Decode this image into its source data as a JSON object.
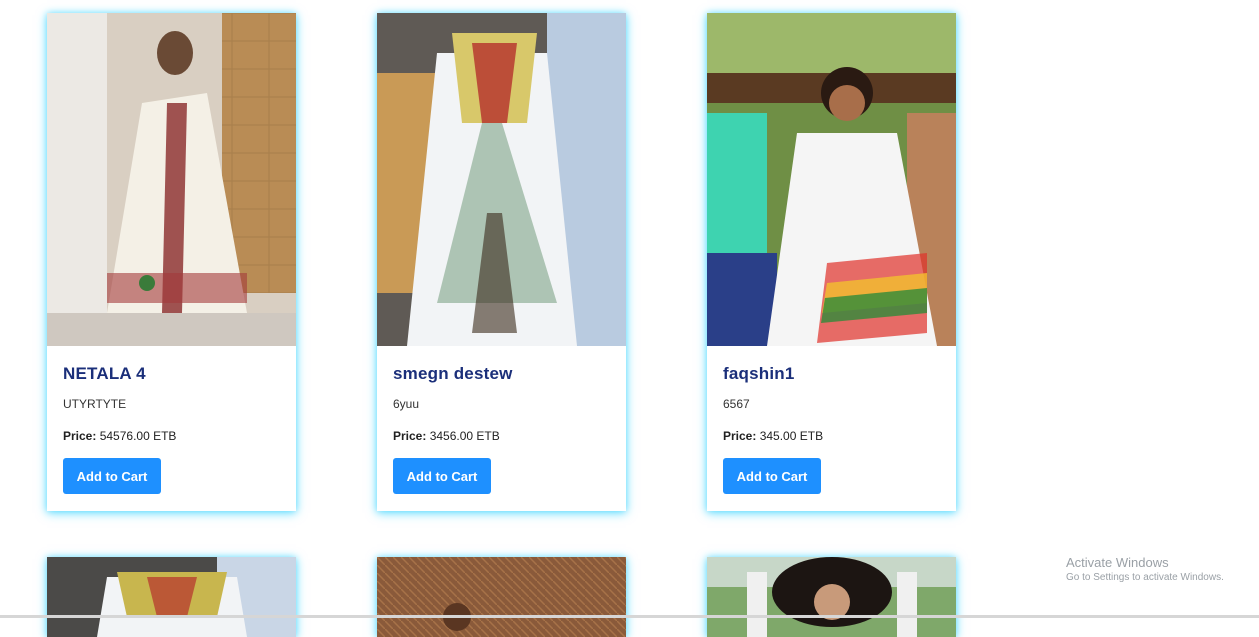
{
  "products": [
    {
      "name": "NETALA 4",
      "description": "UTYRTYTE",
      "price_label": "Price:",
      "price": "54576.00 ETB",
      "button": "Add to Cart",
      "image": "woman-in-white-embroidered-dress"
    },
    {
      "name": "smegn destew",
      "description": "6yuu",
      "price_label": "Price:",
      "price": "3456.00 ETB",
      "button": "Add to Cart",
      "image": "white-dress-colorful-embroidery"
    },
    {
      "name": "faqshin1",
      "description": "6567",
      "price_label": "Price:",
      "price": "345.00 ETB",
      "button": "Add to Cart",
      "image": "woman-seated-white-dress-rainbow-trim"
    }
  ],
  "second_row_images": [
    "dress-embroidered-bodice",
    "straw-wall-portrait",
    "woman-with-curly-hair-outdoors"
  ],
  "watermark": {
    "line1": "Activate Windows",
    "line2": "Go to Settings to activate Windows."
  },
  "colors": {
    "accent": "#1e90ff",
    "title": "#1b2f7a",
    "card_glow": "#00c8ff"
  }
}
